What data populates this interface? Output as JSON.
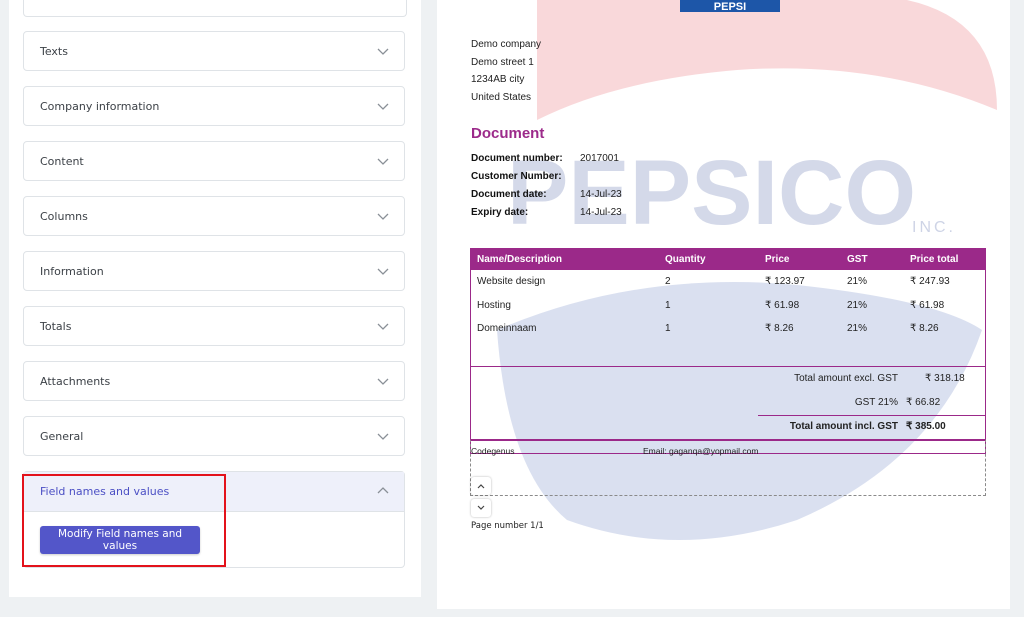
{
  "sidebar": {
    "sections": [
      {
        "label": "Texts"
      },
      {
        "label": "Company information"
      },
      {
        "label": "Content"
      },
      {
        "label": "Columns"
      },
      {
        "label": "Information"
      },
      {
        "label": "Totals"
      },
      {
        "label": "Attachments"
      },
      {
        "label": "General"
      }
    ],
    "open_section": {
      "label": "Field names and values",
      "button_label": "Modify Field names and values"
    }
  },
  "document": {
    "logo_text": "PEPSI",
    "watermark_text": "PEPSICO",
    "watermark_sub": "INC.",
    "sender": [
      "Demo company",
      "Demo street 1",
      "1234AB city",
      "United States"
    ],
    "title": "Document",
    "meta": [
      {
        "label": "Document number:",
        "value": "2017001"
      },
      {
        "label": "Customer Number:",
        "value": ""
      },
      {
        "label": "Document date:",
        "value": "14-Jul-23"
      },
      {
        "label": "Expiry date:",
        "value": "14-Jul-23"
      }
    ],
    "table": {
      "headers": [
        "Name/Description",
        "Quantity",
        "Price",
        "GST",
        "Price total"
      ],
      "rows": [
        [
          "Website design",
          "2",
          "₹ 123.97",
          "21%",
          "₹ 247.93"
        ],
        [
          "Hosting",
          "1",
          "₹ 61.98",
          "21%",
          "₹ 61.98"
        ],
        [
          "Domeinnaam",
          "1",
          "₹ 8.26",
          "21%",
          "₹ 8.26"
        ]
      ]
    },
    "totals": [
      {
        "label": "Total amount excl. GST",
        "value": "₹ 318.18",
        "bold": false
      },
      {
        "label": "GST 21%",
        "value": "₹ 66.82",
        "bold": false
      },
      {
        "label": "Total amount incl. GST",
        "value": "₹ 385.00",
        "bold": true
      }
    ],
    "footer": {
      "company": "Codegenus",
      "email": "Email: gaganqa@yopmail.com"
    },
    "page_number": "Page number 1/1"
  },
  "colors": {
    "accent": "#9b2989",
    "button": "#5356c9",
    "highlight": "#e3121b"
  }
}
